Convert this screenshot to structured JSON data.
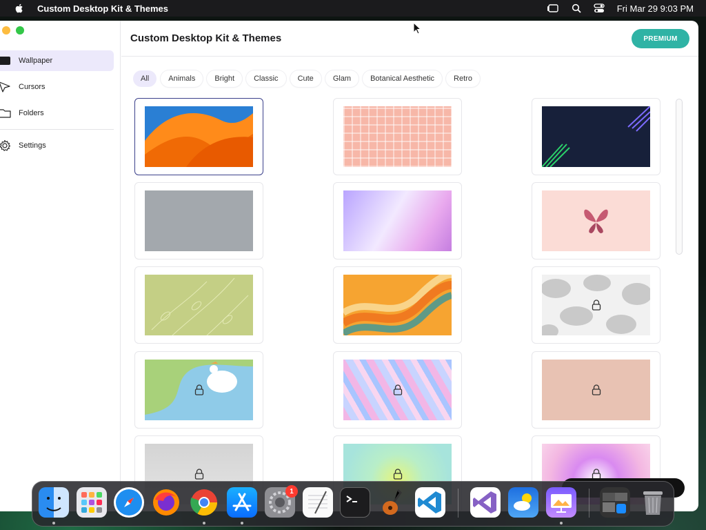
{
  "menubar": {
    "app_name": "Custom Desktop Kit & Themes",
    "datetime": "Fri Mar 29  9:03 PM"
  },
  "sidebar": {
    "items": [
      {
        "label": "Wallpaper",
        "icon": "wallpaper-icon",
        "active": true
      },
      {
        "label": "Cursors",
        "icon": "cursor-icon"
      },
      {
        "label": "Folders",
        "icon": "folder-icon"
      },
      {
        "label": "Settings",
        "icon": "gear-icon"
      }
    ]
  },
  "header": {
    "title": "Custom Desktop Kit & Themes",
    "premium_label": "PREMIUM"
  },
  "filters": [
    "All",
    "Animals",
    "Bright",
    "Classic",
    "Cute",
    "Glam",
    "Botanical Aesthetic",
    "Retro"
  ],
  "wallpapers": [
    {
      "name": "orange-waves",
      "locked": false,
      "selected": true
    },
    {
      "name": "pink-plaid",
      "locked": false
    },
    {
      "name": "neon-lines",
      "locked": false
    },
    {
      "name": "gray-solid",
      "locked": false
    },
    {
      "name": "purple-gradient",
      "locked": false
    },
    {
      "name": "butterfly",
      "locked": false
    },
    {
      "name": "green-leaves",
      "locked": false
    },
    {
      "name": "retro-swirl",
      "locked": false
    },
    {
      "name": "cow-print",
      "locked": true
    },
    {
      "name": "duck-pond",
      "locked": true
    },
    {
      "name": "zebra-pastel",
      "locked": true
    },
    {
      "name": "peach-solid",
      "locked": true
    },
    {
      "name": "gray-blur",
      "locked": true
    },
    {
      "name": "mint-glow",
      "locked": true
    },
    {
      "name": "pink-glow",
      "locked": true
    }
  ],
  "dock": {
    "apps": [
      "finder-icon",
      "launchpad-icon",
      "safari-icon",
      "firefox-icon",
      "chrome-icon",
      "app-store-icon",
      "system-settings-icon",
      "textedit-icon",
      "terminal-icon",
      "garageband-icon",
      "vscode-icon",
      "visual-studio-icon",
      "weather-icon",
      "desktop-kit-icon",
      "downloads-stack-icon",
      "trash-icon"
    ],
    "settings_badge": "1"
  },
  "colors": {
    "accent": "#2fb3a5",
    "selection": "#ece9fb",
    "selected_border": "#3a3f8a"
  }
}
